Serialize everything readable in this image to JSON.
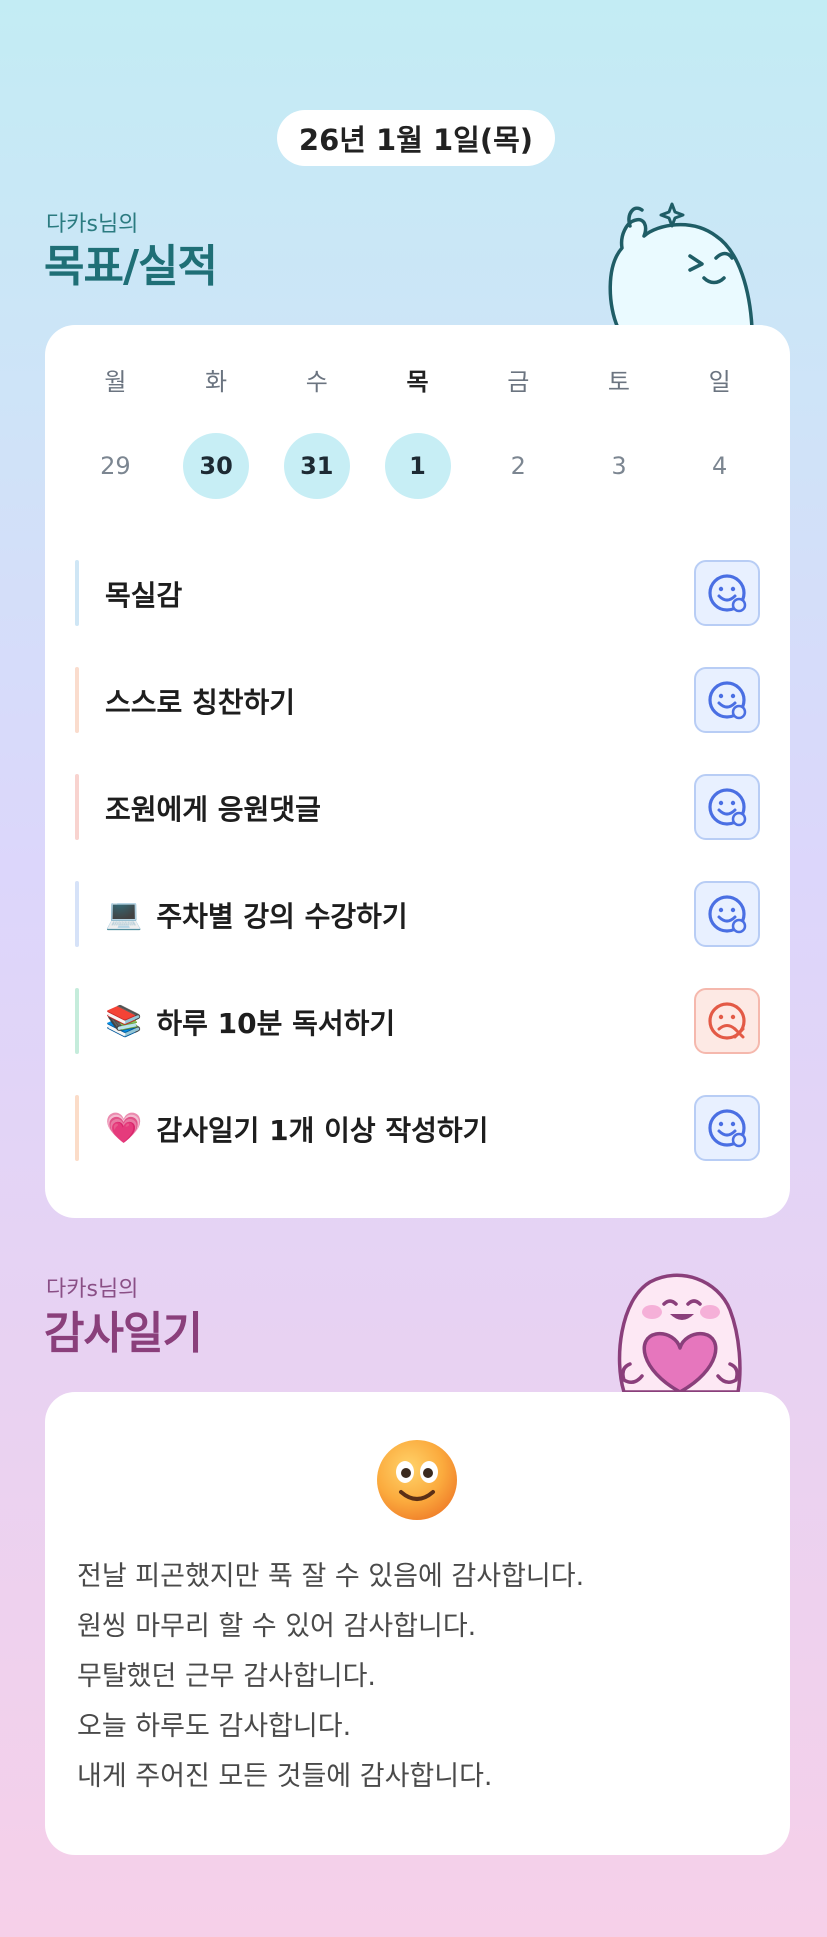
{
  "date_label": "26년 1월 1일(목)",
  "goals_section": {
    "subtitle": "다카s님의",
    "title": "목표/실적"
  },
  "week": [
    {
      "dow": "월",
      "date": "29",
      "done": false,
      "today": false
    },
    {
      "dow": "화",
      "date": "30",
      "done": true,
      "today": false
    },
    {
      "dow": "수",
      "date": "31",
      "done": true,
      "today": false
    },
    {
      "dow": "목",
      "date": "1",
      "done": true,
      "today": true
    },
    {
      "dow": "금",
      "date": "2",
      "done": false,
      "today": false
    },
    {
      "dow": "토",
      "date": "3",
      "done": false,
      "today": false
    },
    {
      "dow": "일",
      "date": "4",
      "done": false,
      "today": false
    }
  ],
  "goals": [
    {
      "label": "목실감",
      "emoji": "",
      "bar_color": "#cfe6f5",
      "status": "smile-icon"
    },
    {
      "label": "스스로 칭찬하기",
      "emoji": "",
      "bar_color": "#fadccd",
      "status": "smile-icon"
    },
    {
      "label": "조원에게 응원댓글",
      "emoji": "",
      "bar_color": "#f8d3cf",
      "status": "smile-icon"
    },
    {
      "label": "주차별 강의 수강하기",
      "emoji": "💻",
      "bar_color": "#d6e2f8",
      "status": "smile-icon"
    },
    {
      "label": "하루 10분 독서하기",
      "emoji": "📚",
      "bar_color": "#c5ecdb",
      "status": "sad-icon"
    },
    {
      "label": "감사일기 1개 이상 작성하기",
      "emoji": "💗",
      "bar_color": "#fbdcc8",
      "status": "smile-icon"
    }
  ],
  "diary_section": {
    "subtitle": "다카s님의",
    "title": "감사일기"
  },
  "diary": {
    "mood_icon": "smiling-face-icon",
    "lines": [
      "전날 피곤했지만 푹 잘 수 있음에 감사합니다.",
      "원씽 마무리 할 수 있어 감사합니다.",
      "무탈했던 근무 감사합니다.",
      "오늘 하루도 감사합니다.",
      "내게 주어진 모든 것들에 감사합니다."
    ]
  },
  "colors": {
    "accent_teal": "#1f6f76",
    "accent_plum": "#8a3f7b",
    "done_circle": "#c7eef5",
    "status_ok_border": "#b8cdf5",
    "status_fail_border": "#f5b8ad"
  }
}
